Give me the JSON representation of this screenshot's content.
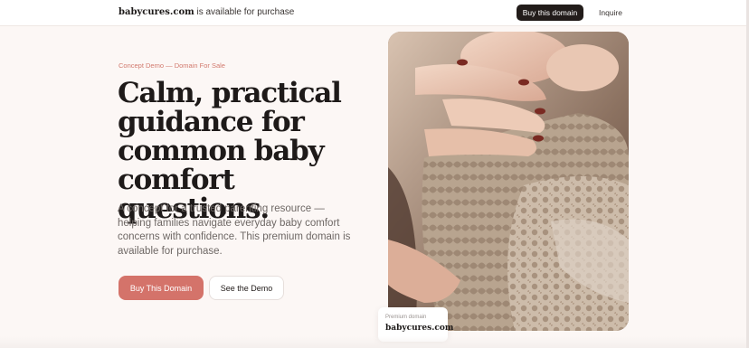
{
  "topbar": {
    "domain": "babycures.com",
    "availability": " is available for purchase",
    "buy_button": "Buy this domain",
    "inquire_link": "Inquire"
  },
  "hero": {
    "eyebrow": "Concept Demo — Domain For Sale",
    "headline": "Calm, practical guidance for common baby comfort questions.",
    "lede": "A concept for a trusted parenting resource — helping families navigate everyday baby comfort concerns with confidence. This premium domain is available for purchase.",
    "primary_button": "Buy This Domain",
    "secondary_button": "See the Demo"
  },
  "badge": {
    "label": "Premium domain",
    "domain": "babycures.com"
  },
  "colors": {
    "accent": "#d4736a",
    "dark": "#221c1a",
    "background": "#fcf7f5"
  }
}
